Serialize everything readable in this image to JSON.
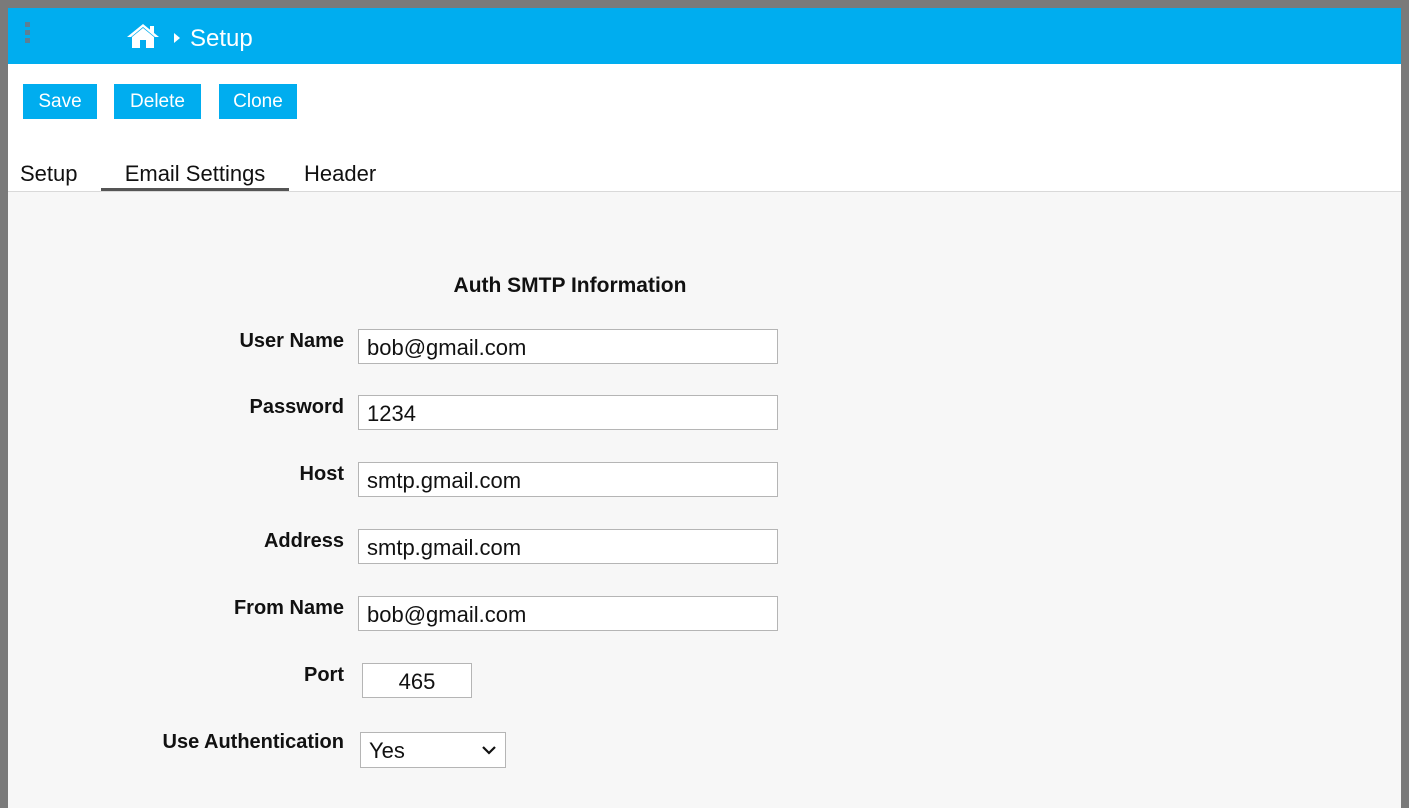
{
  "header": {
    "breadcrumb": "Setup"
  },
  "toolbar": {
    "save_label": "Save",
    "delete_label": "Delete",
    "clone_label": "Clone"
  },
  "tabs": [
    "Setup",
    "Email Settings",
    "Header"
  ],
  "active_tab": "Email Settings",
  "form": {
    "title": "Auth SMTP Information",
    "user_name": {
      "label": "User Name",
      "value": "bob@gmail.com"
    },
    "password": {
      "label": "Password",
      "value": "1234"
    },
    "host": {
      "label": "Host",
      "value": "smtp.gmail.com"
    },
    "address": {
      "label": "Address",
      "value": "smtp.gmail.com"
    },
    "from_name": {
      "label": "From Name",
      "value": "bob@gmail.com"
    },
    "port": {
      "label": "Port",
      "value": "465"
    },
    "use_authentication": {
      "label": "Use Authentication",
      "value": "Yes"
    }
  },
  "icons": {
    "menu": "kebab-menu-icon",
    "home": "home-icon",
    "breadcrumb_separator": "caret-right-icon",
    "dropdown": "chevron-down-icon"
  },
  "colors": {
    "accent": "#00adef",
    "page_background": "#f7f7f7",
    "frame": "#7a7a7a"
  }
}
